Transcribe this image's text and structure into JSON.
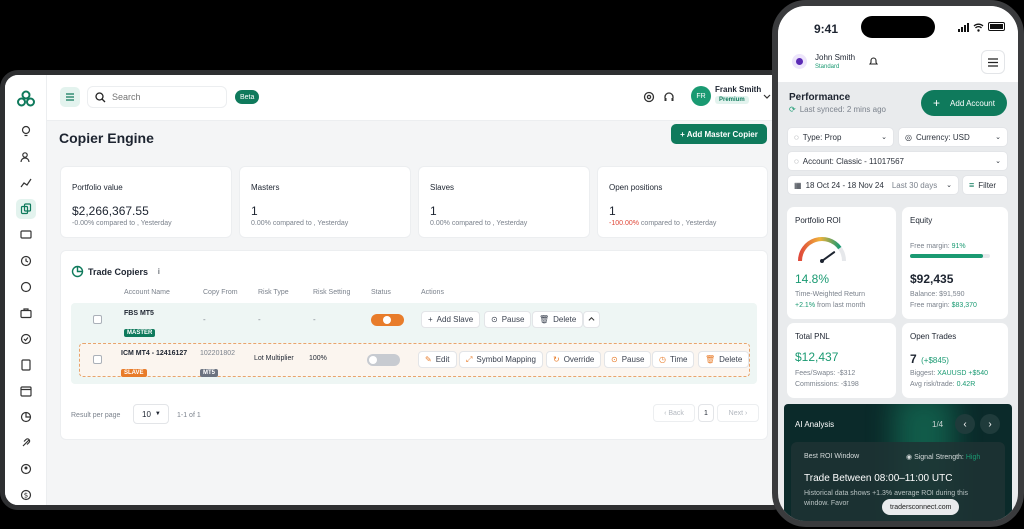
{
  "desktop": {
    "search": {
      "placeholder": "Search"
    },
    "beta_badge": "Beta",
    "user": {
      "name": "Frank Smith",
      "plan": "Premium",
      "initials": "FR"
    },
    "page_title": "Copier Engine",
    "add_master_button": "+ Add Master Copier",
    "stats": [
      {
        "label": "Portfolio value",
        "value": "$2,266,367.55",
        "change": "-0.00%",
        "suffix": "compared to , Yesterday"
      },
      {
        "label": "Masters",
        "value": "1",
        "change": "0.00%",
        "suffix": "compared to , Yesterday"
      },
      {
        "label": "Slaves",
        "value": "1",
        "change": "0.00%",
        "suffix": "compared to , Yesterday"
      },
      {
        "label": "Open positions",
        "value": "1",
        "change": "-100.00%",
        "suffix": "compared to , Yesterday"
      }
    ],
    "trade_copiers": {
      "title": "Trade Copiers",
      "info": "i",
      "columns": [
        "Account Name",
        "Copy From",
        "Risk Type",
        "Risk Setting",
        "Status",
        "Actions"
      ],
      "master_row": {
        "account": "FBS MT5",
        "tag": "MASTER",
        "copy_from": "-",
        "risk_type": "-",
        "risk_setting": "-",
        "actions": [
          "Add Slave",
          "Pause",
          "Delete"
        ]
      },
      "slave_row": {
        "account": "ICM MT4 - 12416127",
        "tag": "SLAVE",
        "copy_from": "102201802",
        "copy_from_tag": "MT5",
        "risk_type": "Lot Multiplier",
        "risk_setting": "100%",
        "actions": [
          "Edit",
          "Symbol Mapping",
          "Override",
          "Pause",
          "Time",
          "Delete"
        ]
      },
      "pagination": {
        "result_label": "Result per page",
        "per_page": "10",
        "range": "1-1 of 1",
        "back": "Back",
        "page": "1",
        "next": "Next"
      }
    }
  },
  "phone": {
    "time": "9:41",
    "user": {
      "name": "John Smith",
      "plan": "Standard"
    },
    "performance": {
      "title": "Performance",
      "synced": "Last synced: 2 mins ago",
      "add_account": "Add Account"
    },
    "filters": {
      "type": "Type: Prop",
      "currency": "Currency: USD",
      "account": "Account: Classic - 11017567",
      "dates": "18 Oct 24 - 18 Nov 24",
      "range": "Last 30 days",
      "filter": "Filter"
    },
    "portfolio_roi": {
      "title": "Portfolio ROI",
      "value": "14.8%",
      "label": "Time-Weighted Return",
      "change": "+2.1%",
      "change_suffix": "from last month",
      "gauge": 0.8
    },
    "equity": {
      "title": "Equity",
      "margin_label": "Free margin:",
      "margin_value": "91%",
      "margin_fraction": 0.91,
      "value": "$92,435",
      "balance": "Balance: $91,590",
      "free_margin_label": "Free margin:",
      "free_margin_value": "$83,370"
    },
    "total_pnl": {
      "title": "Total PNL",
      "value": "$12,437",
      "fees": "Fees/Swaps: -$312",
      "commissions": "Commissions: -$198"
    },
    "open_trades": {
      "title": "Open Trades",
      "count": "7",
      "change": "(+$845)",
      "biggest_label": "Biggest:",
      "biggest_value": "XAUUSD +$540",
      "avg_label": "Avg risk/trade:",
      "avg_value": "0.42R"
    },
    "ai": {
      "title": "AI Analysis",
      "page": "1/4",
      "window_label": "Best ROI Window",
      "signal_label": "Signal Strength:",
      "signal_value": "High",
      "headline": "Trade Between 08:00–11:00 UTC",
      "body": "Historical data shows +1.3% average ROI during this window. Favor",
      "watermark": "tradersconnect.com"
    }
  },
  "colors": {
    "brand": "#0f7a5c",
    "accent": "#1a9a72",
    "orange": "#e87c2a",
    "red": "#e0493a"
  }
}
